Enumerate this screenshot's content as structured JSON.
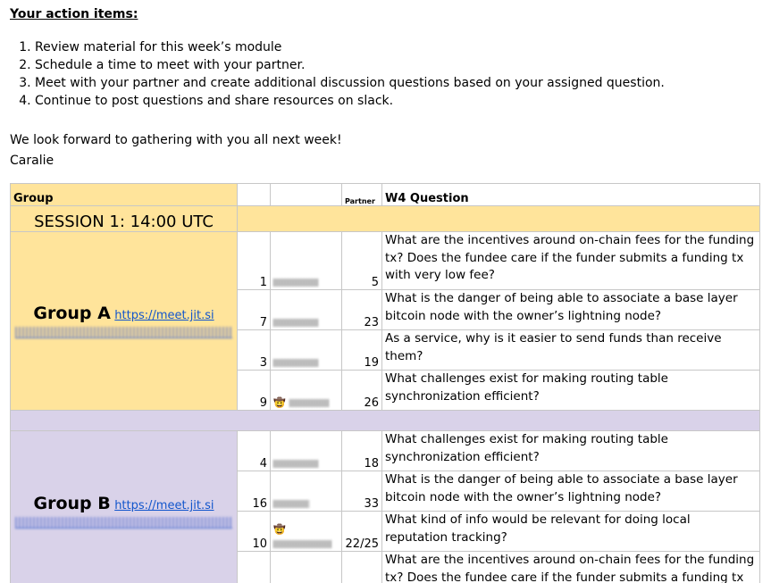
{
  "intro": {
    "heading": "Your action items:",
    "items": [
      "Review material for this week’s module",
      "Schedule a time to meet with your partner.",
      "Meet with your partner and create additional discussion questions based on your assigned question.",
      "Continue to post questions and share resources on slack."
    ],
    "closing": "We look forward to gathering with you all next week!",
    "signature": "Caralie"
  },
  "table": {
    "headers": {
      "group": "Group",
      "partner": "Partner",
      "question": "W4 Question"
    },
    "session_title": "SESSION 1: 14:00 UTC",
    "groups": [
      {
        "name": "Group A",
        "link": "https://meet.jit.si",
        "color": "#ffe49b",
        "rows": [
          {
            "num": "1",
            "partner": "5",
            "question": "What are the incentives around on-chain fees for the funding tx? Does the fundee care if the funder submits a funding tx with very low fee?"
          },
          {
            "num": "7",
            "partner": "23",
            "question": "What is the danger of being able to associate a base layer bitcoin node with the owner’s lightning node?"
          },
          {
            "num": "3",
            "partner": "19",
            "question": "As a service, why is it easier to send funds than receive them?"
          },
          {
            "num": "9",
            "partner": "26",
            "question": "What challenges exist for making routing table synchronization efficient?"
          }
        ]
      },
      {
        "name": "Group B",
        "link": "https://meet.jit.si",
        "color": "#d9d2e9",
        "rows": [
          {
            "num": "4",
            "partner": "18",
            "question": "What challenges exist for making routing table synchronization efficient?"
          },
          {
            "num": "16",
            "partner": "33",
            "question": "What is the danger of being able to associate a base layer bitcoin node with the owner’s lightning node?"
          },
          {
            "num": "10",
            "partner": "22/25",
            "question": "What kind of info would be relevant for doing local reputation tracking?"
          },
          {
            "num": "",
            "partner": "",
            "question": "What are the incentives around on-chain fees for the funding tx? Does the fundee care if the funder submits a funding tx"
          }
        ]
      }
    ],
    "emoji": "🤠"
  }
}
